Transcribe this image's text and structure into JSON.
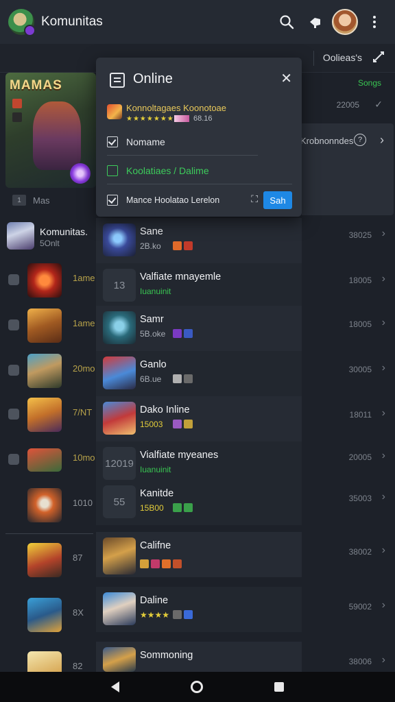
{
  "app": {
    "title": "Komunitas"
  },
  "subbar": {
    "label": "Oolieas's"
  },
  "featured": {
    "banner": "MAMAS",
    "tab_label": "Mas",
    "tab_box": "1"
  },
  "community": {
    "name": "Komunitas.",
    "sub": "5Onlt"
  },
  "right_panel": {
    "top_status": "Songs",
    "top_num": "22005",
    "band_label": "Krobnonndes"
  },
  "popup": {
    "title": "Online",
    "game_title": "Konnoltagaes Koonotoae",
    "game_count": "68.16",
    "item_1": "Nomame",
    "item_2": "Koolatiaes / Dalime",
    "item_3": "Mance Hoolatao Lerelon",
    "button": "Sah"
  },
  "left_list": [
    {
      "meta": "1ame",
      "num_style": "gold"
    },
    {
      "meta": "1ame",
      "num_style": "gold"
    },
    {
      "meta": "20mo",
      "num_style": "gold"
    },
    {
      "meta": "7/NT",
      "num_style": "gold"
    },
    {
      "meta": "10mo",
      "num_style": "gold"
    },
    {
      "meta": "1010",
      "num_style": "grey"
    },
    {
      "meta": "87",
      "num_style": "grey"
    },
    {
      "meta": "8X",
      "num_style": "grey"
    },
    {
      "meta": "82",
      "num_style": "grey"
    }
  ],
  "cards": [
    {
      "title": "Sane",
      "sub": "2B.ko",
      "right": "38025"
    },
    {
      "title": "Valfiate mnayemle",
      "sub": "Iuanuinit",
      "placeholder": "13",
      "right": "18005"
    },
    {
      "title": "Samr",
      "sub": "5B.oke",
      "right": "18005"
    },
    {
      "title": "Ganlo",
      "sub": "6B.ue",
      "right": "30005"
    },
    {
      "title": "Dako Inline",
      "sub": "15003",
      "right": "18011"
    },
    {
      "title": "Vialfiate myeanes",
      "sub": "Iuanuinit",
      "placeholder": "12019",
      "right": "20005"
    },
    {
      "title": "Kanitde",
      "sub": "15B00",
      "placeholder": "55",
      "right": "35003"
    },
    {
      "title": "Califne",
      "sub": "",
      "right": "38002"
    },
    {
      "title": "Daline",
      "sub": "★★★★",
      "right": "59002"
    },
    {
      "title": "Sommoning",
      "sub": "",
      "right": "38006"
    }
  ],
  "icons": [
    "search-icon",
    "pin-icon",
    "more-icon",
    "expand-icon",
    "close-icon",
    "help-icon",
    "chevron-right-icon"
  ]
}
